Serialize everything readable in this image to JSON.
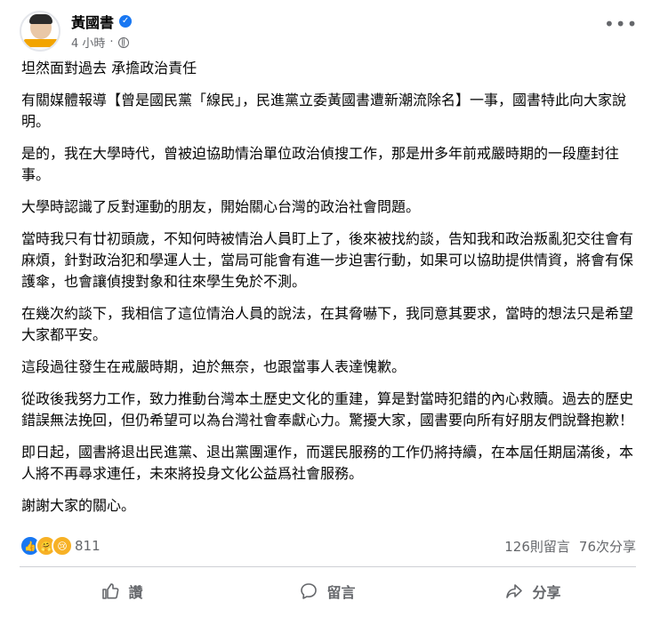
{
  "post": {
    "author": "黃國書",
    "time": "4 小時",
    "verified_icon": "✓",
    "paragraphs": [
      "坦然面對過去 承擔政治責任",
      "有關媒體報導【曾是國民黨「線民」，民進黨立委黃國書遭新潮流除名】一事，國書特此向大家說明。",
      "是的，我在大學時代，曾被迫協助情治單位政治偵搜工作，那是卅多年前戒嚴時期的一段塵封往事。",
      "大學時認識了反對運動的朋友，開始關心台灣的政治社會問題。",
      "當時我只有廿初頭歲，不知何時被情治人員盯上了，後來被找約談，告知我和政治叛亂犯交往會有麻煩，針對政治犯和學運人士，當局可能會有進一步迫害行動，如果可以協助提供情資，將會有保護傘，也會讓偵搜對象和往來學生免於不測。",
      "在幾次約談下，我相信了這位情治人員的說法，在其脅嚇下，我同意其要求，當時的想法只是希望大家都平安。",
      "這段過往發生在戒嚴時期，迫於無奈，也跟當事人表達愧歉。",
      "從政後我努力工作，致力推動台灣本土歷史文化的重建，算是對當時犯錯的內心救贖。過去的歷史錯誤無法挽回，但仍希望可以為台灣社會奉獻心力。驚擾大家，國書要向所有好朋友們說聲抱歉！",
      "即日起，國書將退出民進黨、退出黨團運作，而選民服務的工作仍將持續，在本屆任期屆滿後，本人將不再尋求連任，未來將投身文化公益爲社會服務。",
      "謝謝大家的關心。"
    ]
  },
  "stats": {
    "reaction_count": "811",
    "comments": "126則留言",
    "shares": "76次分享"
  },
  "actions": {
    "like": "讚",
    "comment": "留言",
    "share": "分享"
  },
  "icons": {
    "more": "•••",
    "like_reaction": "like-icon",
    "care_reaction": "care-icon",
    "sad_reaction": "sad-icon"
  },
  "colors": {
    "brand": "#1877f2",
    "secondary_text": "#65676b"
  }
}
